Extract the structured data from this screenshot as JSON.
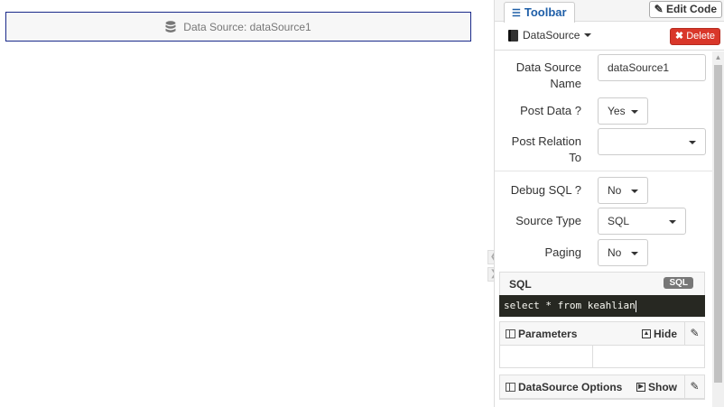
{
  "canvas": {
    "widget_label": "Data Source: dataSource1",
    "widget_icon": "database-icon"
  },
  "panel": {
    "tab_label": "Toolbar",
    "edit_code_label": "Edit Code",
    "datasource_label": "DataSource",
    "delete_label": "Delete",
    "colors": {
      "delete": "#d9372a",
      "tab_text": "#1f5fa8",
      "sql_bg": "#272822"
    }
  },
  "props": {
    "name_label": "Data Source Name",
    "name_value": "dataSource1",
    "post_data_label": "Post Data ?",
    "post_data_value": "Yes",
    "post_relation_label": "Post Relation To",
    "post_relation_value": "",
    "debug_sql_label": "Debug SQL ?",
    "debug_sql_value": "No",
    "source_type_label": "Source Type",
    "source_type_value": "SQL",
    "paging_label": "Paging",
    "paging_value": "No"
  },
  "sql": {
    "title": "SQL",
    "badge": "SQL",
    "query": "select * from keahlian"
  },
  "parameters": {
    "title": "Parameters",
    "toggle": "Hide"
  },
  "ds_options": {
    "title": "DataSource Options",
    "toggle": "Show"
  }
}
